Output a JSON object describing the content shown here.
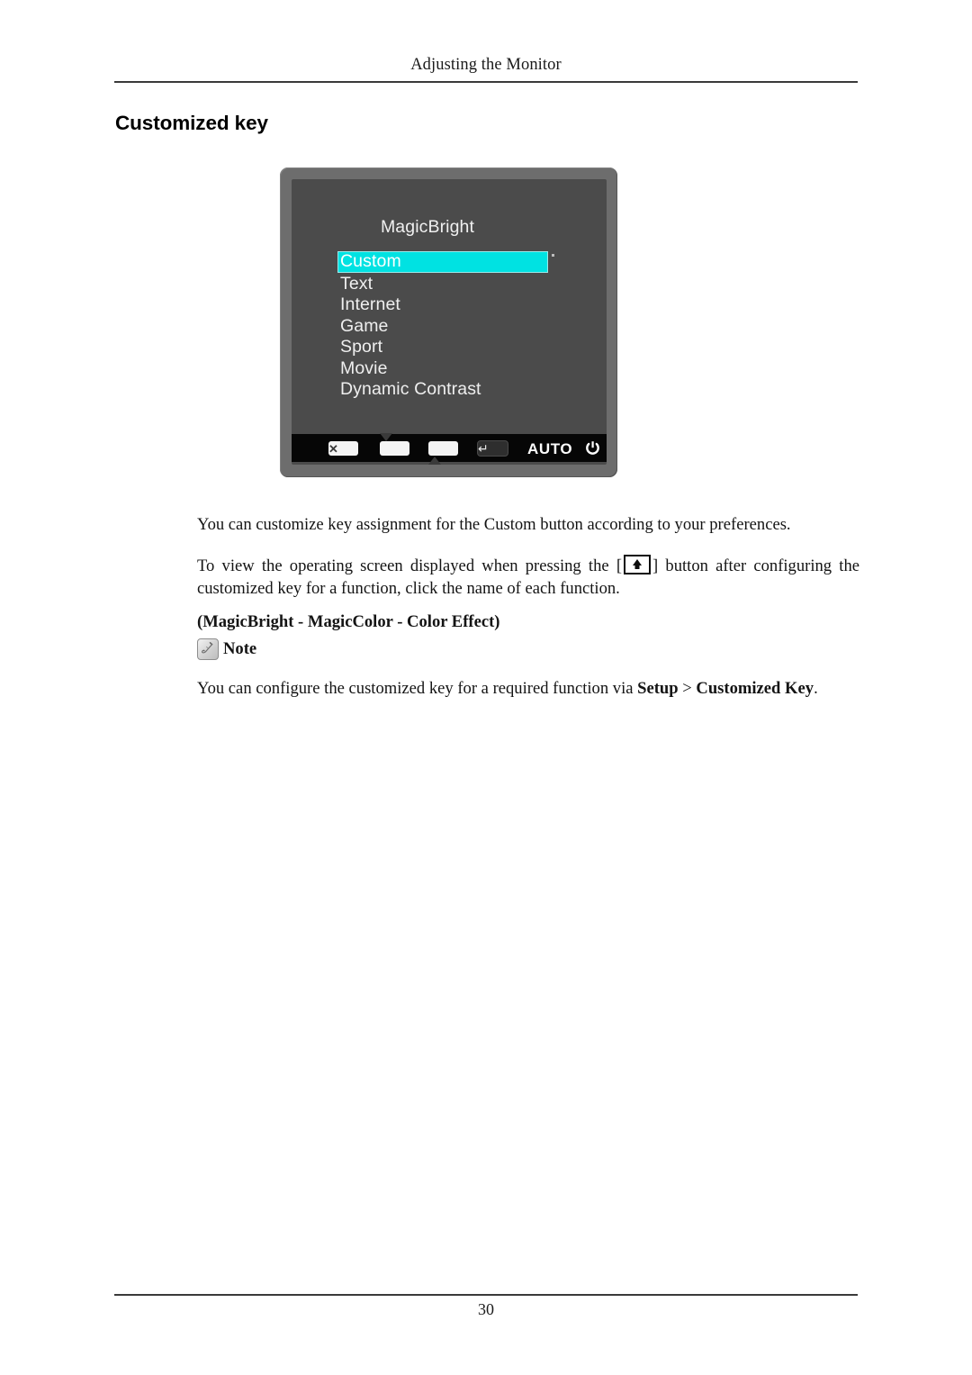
{
  "header": {
    "title": "Adjusting the Monitor"
  },
  "heading": "Customized key",
  "osd": {
    "title": "MagicBright",
    "items": [
      {
        "label": "Custom",
        "selected": true
      },
      {
        "label": "Text",
        "selected": false
      },
      {
        "label": "Internet",
        "selected": false
      },
      {
        "label": "Game",
        "selected": false
      },
      {
        "label": "Sport",
        "selected": false
      },
      {
        "label": "Movie",
        "selected": false
      },
      {
        "label": "Dynamic Contrast",
        "selected": false
      }
    ],
    "toolbar": {
      "close_icon": "close-x-icon",
      "down_icon": "arrow-down-icon",
      "up_icon": "arrow-up-icon",
      "enter_icon": "enter-return-icon",
      "enter_glyph": "↵",
      "auto_label": "AUTO",
      "power_icon": "power-icon"
    },
    "colors": {
      "bezel": "#6d6d6d",
      "screen": "#4b4b4b",
      "highlight": "#00e2e2",
      "toolbar_bg": "#060606",
      "text": "#efefef"
    }
  },
  "body": {
    "paragraph1": "You can customize key assignment for the Custom button according to your preferences.",
    "paragraph2_before": "To view the operating screen displayed when pressing the [",
    "paragraph2_after": "] button after configuring the customized key for a function, click the name of each function.",
    "paragraph2_inline_icon": "custom-key-button-icon",
    "paragraph3": "(MagicBright - MagicColor - Color Effect)",
    "note_icon": "note-pencil-icon",
    "note_label": "Note",
    "paragraph5_part1": "You can configure the customized key for a required function via ",
    "paragraph5_bold1": "Setup",
    "paragraph5_part2": " > ",
    "paragraph5_bold2": "Customized Key",
    "paragraph5_part3": "."
  },
  "footer": {
    "page_number": "30"
  }
}
